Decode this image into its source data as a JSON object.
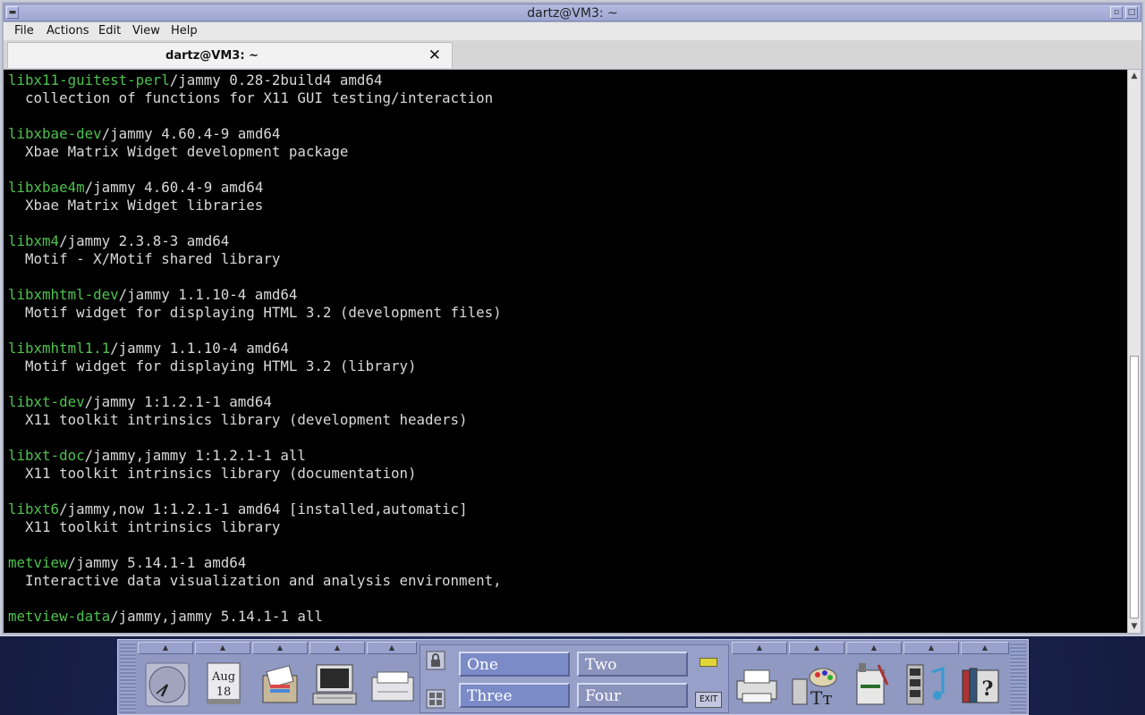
{
  "window": {
    "title": "dartz@VM3: ~"
  },
  "menubar": {
    "items": [
      "File",
      "Actions",
      "Edit",
      "View",
      "Help"
    ]
  },
  "tab": {
    "label": "dartz@VM3: ~",
    "close_glyph": "✕"
  },
  "terminal": {
    "lines": [
      {
        "pkg": "libx11-guitest-perl",
        "rest": "/jammy 0.28-2build4 amd64"
      },
      {
        "pkg": "",
        "rest": "  collection of functions for X11 GUI testing/interaction"
      },
      {
        "pkg": "",
        "rest": ""
      },
      {
        "pkg": "libxbae-dev",
        "rest": "/jammy 4.60.4-9 amd64"
      },
      {
        "pkg": "",
        "rest": "  Xbae Matrix Widget development package"
      },
      {
        "pkg": "",
        "rest": ""
      },
      {
        "pkg": "libxbae4m",
        "rest": "/jammy 4.60.4-9 amd64"
      },
      {
        "pkg": "",
        "rest": "  Xbae Matrix Widget libraries"
      },
      {
        "pkg": "",
        "rest": ""
      },
      {
        "pkg": "libxm4",
        "rest": "/jammy 2.3.8-3 amd64"
      },
      {
        "pkg": "",
        "rest": "  Motif - X/Motif shared library"
      },
      {
        "pkg": "",
        "rest": ""
      },
      {
        "pkg": "libxmhtml-dev",
        "rest": "/jammy 1.1.10-4 amd64"
      },
      {
        "pkg": "",
        "rest": "  Motif widget for displaying HTML 3.2 (development files)"
      },
      {
        "pkg": "",
        "rest": ""
      },
      {
        "pkg": "libxmhtml1.1",
        "rest": "/jammy 1.1.10-4 amd64"
      },
      {
        "pkg": "",
        "rest": "  Motif widget for displaying HTML 3.2 (library)"
      },
      {
        "pkg": "",
        "rest": ""
      },
      {
        "pkg": "libxt-dev",
        "rest": "/jammy 1:1.2.1-1 amd64"
      },
      {
        "pkg": "",
        "rest": "  X11 toolkit intrinsics library (development headers)"
      },
      {
        "pkg": "",
        "rest": ""
      },
      {
        "pkg": "libxt-doc",
        "rest": "/jammy,jammy 1:1.2.1-1 all"
      },
      {
        "pkg": "",
        "rest": "  X11 toolkit intrinsics library (documentation)"
      },
      {
        "pkg": "",
        "rest": ""
      },
      {
        "pkg": "libxt6",
        "rest": "/jammy,now 1:1.2.1-1 amd64 [installed,automatic]"
      },
      {
        "pkg": "",
        "rest": "  X11 toolkit intrinsics library"
      },
      {
        "pkg": "",
        "rest": ""
      },
      {
        "pkg": "metview",
        "rest": "/jammy 5.14.1-1 amd64"
      },
      {
        "pkg": "",
        "rest": "  Interactive data visualization and analysis environment,"
      },
      {
        "pkg": "",
        "rest": ""
      },
      {
        "pkg": "metview-data",
        "rest": "/jammy,jammy 5.14.1-1 all"
      }
    ],
    "colors": {
      "background": "#000000",
      "text": "#d9d9d9",
      "package": "#4ec24e"
    }
  },
  "panel": {
    "calendar": {
      "month": "Aug",
      "day": "18"
    },
    "workspaces": [
      {
        "label": "One",
        "active": true
      },
      {
        "label": "Two",
        "active": false
      },
      {
        "label": "Three",
        "active": true
      },
      {
        "label": "Four",
        "active": false
      }
    ],
    "exit_label": "EXIT",
    "left_icons": [
      "clock-icon",
      "calendar-icon",
      "file-manager-icon",
      "terminal-computer-icon",
      "mailer-icon"
    ],
    "right_icons": [
      "printer-icon",
      "style-manager-icon",
      "text-editor-icon",
      "media-player-icon",
      "help-manager-icon"
    ]
  }
}
